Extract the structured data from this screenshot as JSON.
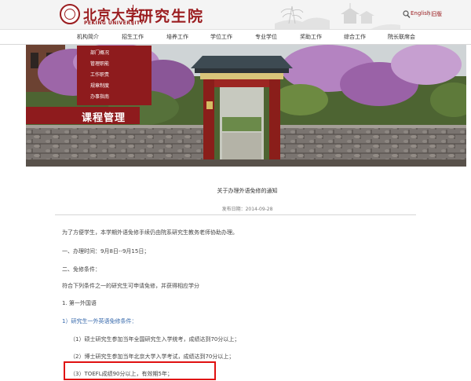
{
  "header": {
    "logo_cn": "北京大学",
    "logo_en": "PEKING UNIVERSITY",
    "department": "研究生院",
    "lang_english": "English",
    "lang_old": "旧版"
  },
  "nav": {
    "items": [
      {
        "label": "机构简介"
      },
      {
        "label": "招生工作"
      },
      {
        "label": "培养工作"
      },
      {
        "label": "学位工作"
      },
      {
        "label": "专业学位"
      },
      {
        "label": "奖助工作"
      },
      {
        "label": "综合工作"
      },
      {
        "label": "院长联席会"
      }
    ]
  },
  "submenu": {
    "items": [
      {
        "label": "部门概况"
      },
      {
        "label": "管理职能"
      },
      {
        "label": "工作职责"
      },
      {
        "label": "规章制度"
      },
      {
        "label": "办事指南"
      }
    ]
  },
  "banner": {
    "section_title": "课程管理"
  },
  "article": {
    "title": "关于办理外语免修的通知",
    "date": "发布日期：2014-09-28",
    "paragraphs": [
      "为了方便学生，本学期外语免修手续仍由院系研究生教务老师协助办理。",
      "一、办理时间：9月8日--9月15日；",
      "二、免修条件：",
      "符合下列条件之一的研究生可申请免修，并获得相应学分",
      "1. 第一外国语",
      "1）研究生一外英语免修条件：",
      "（1）硕士研究生参加当年全国研究生入学统考，成绩达到70分以上；",
      "（2）博士研究生参加当年北京大学入学考试，成绩达到70分以上；",
      "（3）TOEFL成绩90分以上，有效期5年；"
    ]
  }
}
